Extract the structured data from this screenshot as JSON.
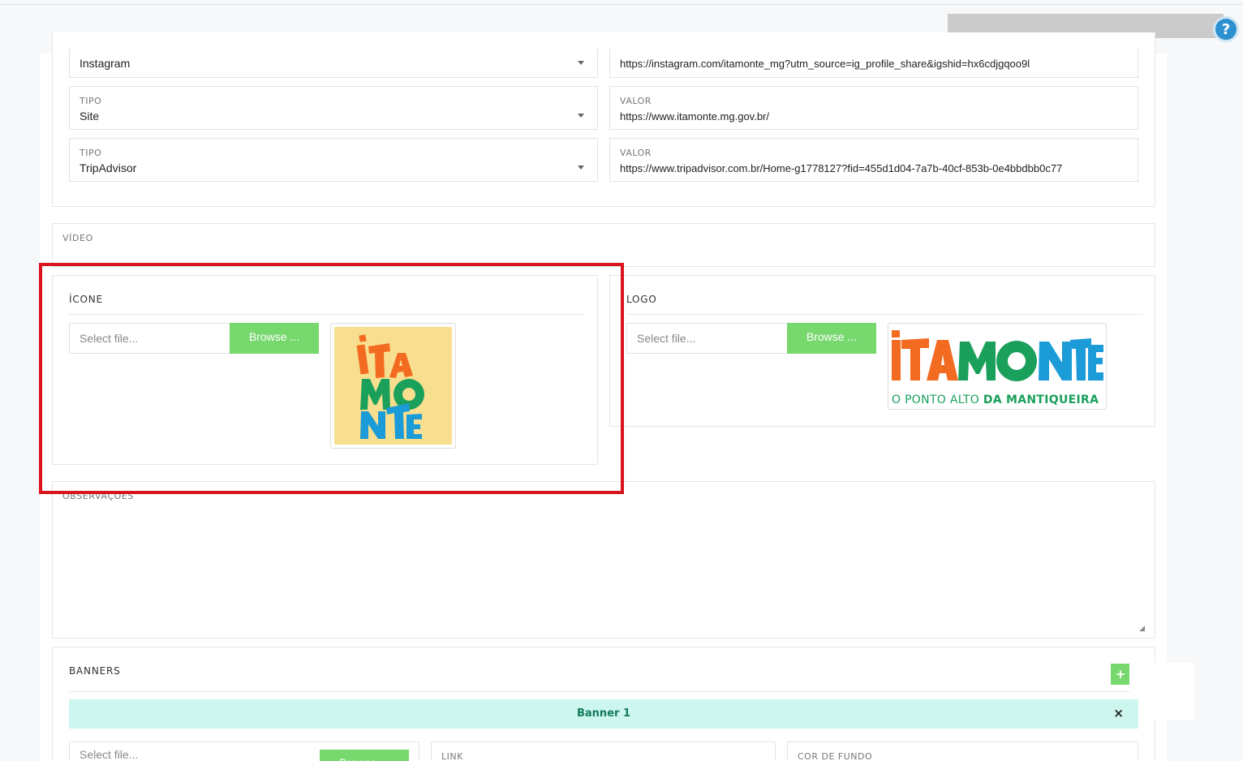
{
  "social_links": [
    {
      "tipo_label": "",
      "tipo": "Instagram",
      "valor_label": "",
      "valor": "https://instagram.com/itamonte_mg?utm_source=ig_profile_share&igshid=hx6cdjgqoo9l"
    },
    {
      "tipo_label": "TIPO",
      "tipo": "Site",
      "valor_label": "VALOR",
      "valor": "https://www.itamonte.mg.gov.br/"
    },
    {
      "tipo_label": "TIPO",
      "tipo": "TripAdvisor",
      "valor_label": "VALOR",
      "valor": "https://www.tripadvisor.com.br/Home-g1778127?fid=455d1d04-7a7b-40cf-853b-0e4bbdbb0c77"
    }
  ],
  "video": {
    "label": "VÍDEO"
  },
  "icone": {
    "title": "ÍCONE",
    "placeholder": "Select file...",
    "browse_label": "Browse ...",
    "preview_letters": [
      "i",
      "T",
      "A",
      "M",
      "O",
      "N",
      "T",
      "E"
    ]
  },
  "logo": {
    "title": "LOGO",
    "placeholder": "Select file...",
    "browse_label": "Browse ...",
    "wordmark": [
      "i",
      "T",
      "A",
      "M",
      "O",
      "N",
      "T",
      "E"
    ],
    "tagline_light": "O PONTO ALTO",
    "tagline_bold": "DA MANTIQUEIRA"
  },
  "observacoes": {
    "label": "OBSERVAÇÕES"
  },
  "banners": {
    "title": "BANNERS",
    "add_label": "+",
    "items": [
      {
        "title": "Banner 1",
        "close": "×",
        "placeholder": "Select file...",
        "browse_label": "Browse ...",
        "link_label": "LINK",
        "cor_label": "COR DE FUNDO"
      }
    ]
  },
  "colors": {
    "accent_green": "#77d86e",
    "highlight_red": "#d9141e",
    "logo_orange": "#f26b21",
    "logo_green": "#1aa05b",
    "logo_blue": "#1b9bd8",
    "icon_background": "#f8df8f",
    "banner_bar": "#cdf6ef"
  }
}
